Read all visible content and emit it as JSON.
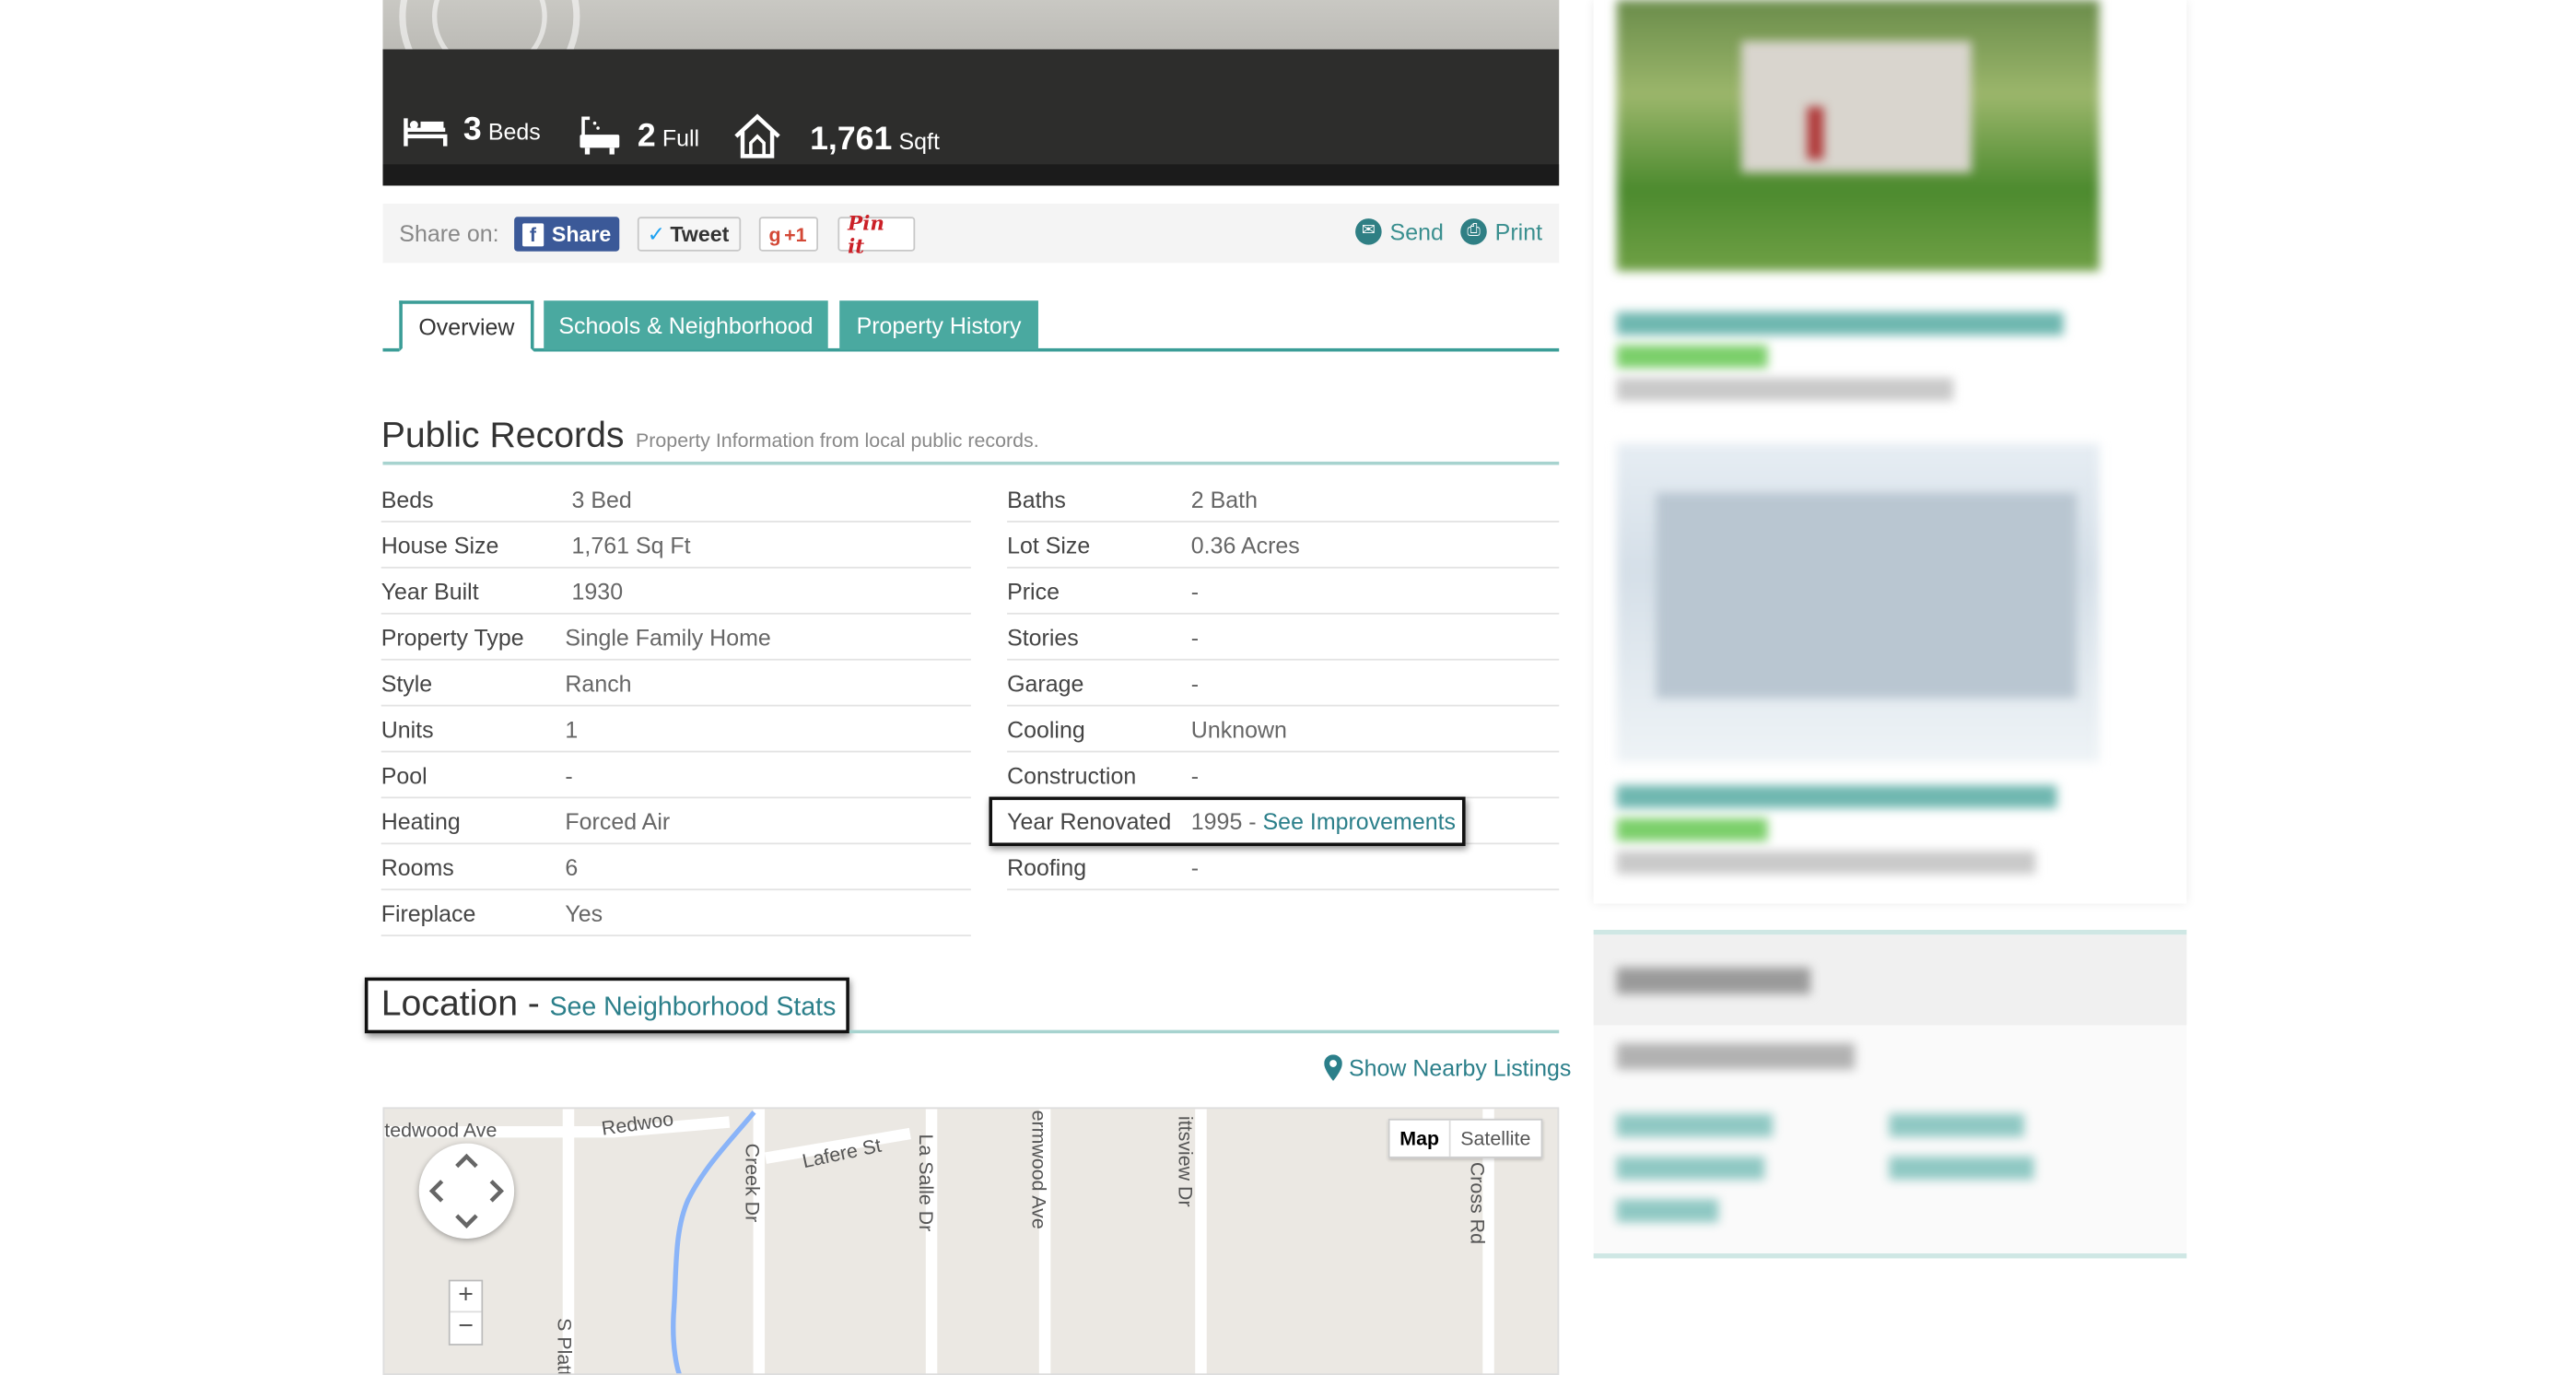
{
  "summary": {
    "beds_num": "3",
    "beds_unit": "Beds",
    "baths_num": "2",
    "baths_unit": "Full",
    "sqft_num": "1,761",
    "sqft_unit": "Sqft"
  },
  "share": {
    "label": "Share on:",
    "facebook": "Share",
    "twitter": "Tweet",
    "gplus": "+1",
    "pinterest": "Pin it",
    "send": "Send",
    "print": "Print"
  },
  "tabs": {
    "overview": "Overview",
    "schools": "Schools & Neighborhood",
    "history": "Property History"
  },
  "public_records": {
    "title": "Public Records",
    "subtitle": "Property Information from local public records.",
    "left": [
      {
        "label": "Beds",
        "value": "3 Bed"
      },
      {
        "label": "House Size",
        "value": "1,761 Sq Ft"
      },
      {
        "label": "Year Built",
        "value": "1930"
      },
      {
        "label": "Property Type",
        "value": "Single Family Home"
      },
      {
        "label": "Style",
        "value": "Ranch"
      },
      {
        "label": "Units",
        "value": "1"
      },
      {
        "label": "Pool",
        "value": "-"
      },
      {
        "label": "Heating",
        "value": "Forced Air"
      },
      {
        "label": "Rooms",
        "value": "6"
      },
      {
        "label": "Fireplace",
        "value": "Yes"
      }
    ],
    "right": [
      {
        "label": "Baths",
        "value": "2 Bath"
      },
      {
        "label": "Lot Size",
        "value": "0.36 Acres"
      },
      {
        "label": "Price",
        "value": "-"
      },
      {
        "label": "Stories",
        "value": "-"
      },
      {
        "label": "Garage",
        "value": "-"
      },
      {
        "label": "Cooling",
        "value": "Unknown"
      },
      {
        "label": "Construction",
        "value": "-"
      },
      {
        "label": "Year Renovated",
        "value": "1995 - ",
        "link": "See Improvements"
      },
      {
        "label": "Roofing",
        "value": "-"
      }
    ]
  },
  "location": {
    "title": "Location",
    "dash": "-",
    "link": "See Neighborhood Stats",
    "nearby": "Show Nearby Listings"
  },
  "map": {
    "type_map": "Map",
    "type_satellite": "Satellite",
    "zoom_in": "+",
    "zoom_out": "−",
    "streets": [
      "tedwood Ave",
      "Redwoo",
      "Lafere St",
      "Creek Dr",
      "La Salle Dr",
      "ermwood Ave",
      "ittsview Dr",
      "ng Cross Rd",
      "S Platt"
    ]
  },
  "colors": {
    "accent": "#3b9d97",
    "link": "#2b7f8a",
    "tab_inactive": "#4aa9a0"
  },
  "icons": [
    "bed-icon",
    "bathtub-icon",
    "house-icon",
    "facebook-icon",
    "twitter-icon",
    "send-icon",
    "print-icon",
    "map-pin-icon"
  ]
}
